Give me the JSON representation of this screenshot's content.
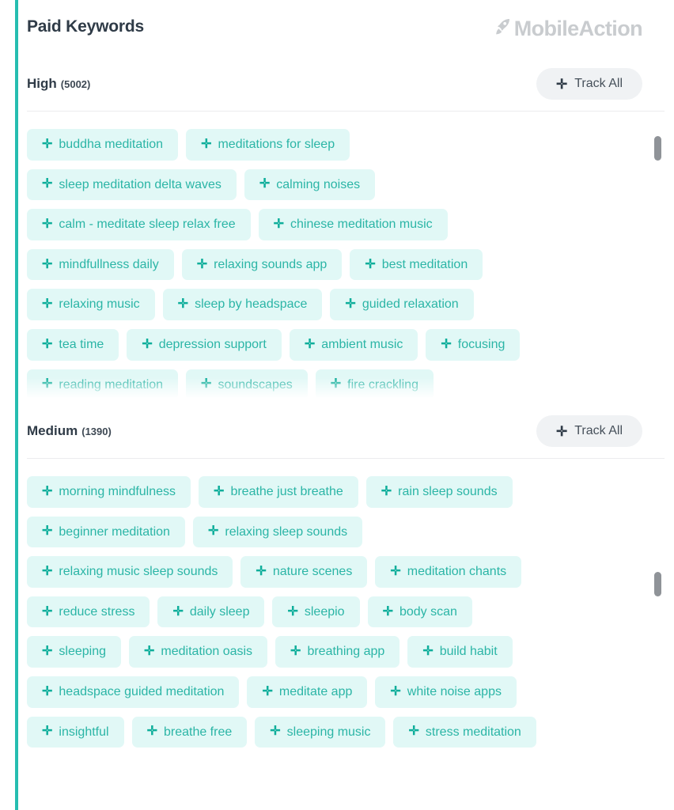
{
  "header": {
    "title": "Paid Keywords",
    "brand_name": "MobileAction",
    "brand_icon": "rocket-icon"
  },
  "colors": {
    "accent": "#25bdb0",
    "tag_bg": "#e1f8f6",
    "tag_text": "#2bb5a6",
    "title_text": "#2f3b47",
    "button_bg": "#f0f2f4",
    "brand_gray": "#c9cccf",
    "scrollbar": "#8f9398"
  },
  "sections": [
    {
      "id": "high",
      "label": "High",
      "count": "(5002)",
      "track_all_label": "Track All",
      "plus_glyph": "✛",
      "rows": [
        [
          "buddha meditation",
          "meditations for sleep"
        ],
        [
          "sleep meditation delta waves",
          "calming noises"
        ],
        [
          "calm - meditate sleep relax free",
          "chinese meditation music"
        ],
        [
          "mindfullness daily",
          "relaxing sounds app",
          "best meditation"
        ],
        [
          "relaxing music",
          "sleep by headspace",
          "guided relaxation"
        ],
        [
          "tea time",
          "depression support",
          "ambient music",
          "focusing"
        ],
        [
          "reading meditation",
          "soundscapes",
          "fire crackling"
        ],
        [
          "",
          "",
          ""
        ]
      ]
    },
    {
      "id": "medium",
      "label": "Medium",
      "count": "(1390)",
      "track_all_label": "Track All",
      "plus_glyph": "✛",
      "rows": [
        [
          "morning mindfulness",
          "breathe just breathe",
          "rain sleep sounds"
        ],
        [
          "beginner meditation",
          "relaxing sleep sounds"
        ],
        [
          "relaxing music sleep sounds",
          "nature scenes",
          "meditation chants"
        ],
        [
          "reduce stress",
          "daily sleep",
          "sleepio",
          "body scan"
        ],
        [
          "sleeping",
          "meditation oasis",
          "breathing app",
          "build habit"
        ],
        [
          "headspace guided meditation",
          "meditate app",
          "white noise apps"
        ],
        [
          "insightful",
          "breathe free",
          "sleeping music",
          "stress meditation"
        ]
      ]
    }
  ]
}
